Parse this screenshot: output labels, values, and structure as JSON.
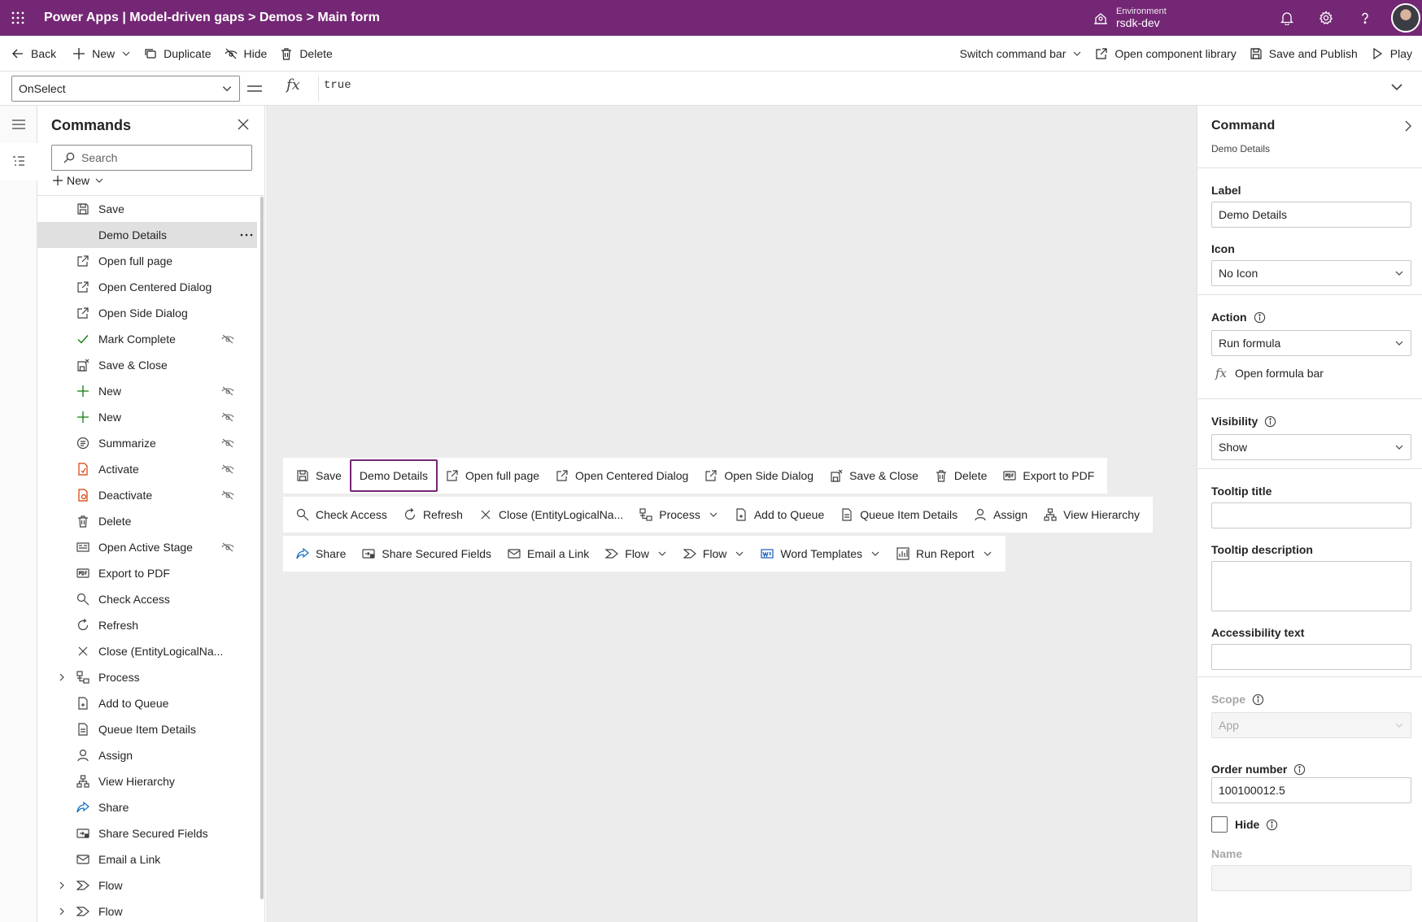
{
  "header": {
    "app_title": "Power Apps | Model-driven gaps > Demos > Main form",
    "env_label": "Environment",
    "env_name": "rsdk-dev",
    "brand_color": "#742774"
  },
  "command_bar": {
    "back": "Back",
    "new": "New",
    "duplicate": "Duplicate",
    "hide": "Hide",
    "delete": "Delete",
    "switch_command_bar": "Switch command bar",
    "open_component_library": "Open component library",
    "save_and_publish": "Save and Publish",
    "play": "Play"
  },
  "formula_bar": {
    "property": "OnSelect",
    "fx": "fx",
    "formula": "true"
  },
  "commands_panel": {
    "title": "Commands",
    "search_placeholder": "Search",
    "new_label": "New",
    "items": [
      {
        "label": "Save",
        "icon": "save-icon",
        "hidden": false,
        "expandable": false
      },
      {
        "label": "Demo Details",
        "icon": "none",
        "hidden": false,
        "expandable": false,
        "selected": true
      },
      {
        "label": "Open full page",
        "icon": "open-in-new-icon",
        "hidden": false,
        "expandable": false
      },
      {
        "label": "Open Centered Dialog",
        "icon": "open-in-new-icon",
        "hidden": false,
        "expandable": false
      },
      {
        "label": "Open Side Dialog",
        "icon": "open-in-new-icon",
        "hidden": false,
        "expandable": false
      },
      {
        "label": "Mark Complete",
        "icon": "checkmark-icon",
        "hidden": true,
        "expandable": false
      },
      {
        "label": "Save & Close",
        "icon": "save-close-icon",
        "hidden": false,
        "expandable": false
      },
      {
        "label": "New",
        "icon": "plus-icon",
        "hidden": true,
        "expandable": false
      },
      {
        "label": "New",
        "icon": "plus-icon",
        "hidden": true,
        "expandable": false
      },
      {
        "label": "Summarize",
        "icon": "summarize-icon",
        "hidden": true,
        "expandable": false
      },
      {
        "label": "Activate",
        "icon": "activate-icon",
        "hidden": true,
        "expandable": false
      },
      {
        "label": "Deactivate",
        "icon": "deactivate-icon",
        "hidden": true,
        "expandable": false
      },
      {
        "label": "Delete",
        "icon": "trash-icon",
        "hidden": false,
        "expandable": false
      },
      {
        "label": "Open Active Stage",
        "icon": "stage-icon",
        "hidden": true,
        "expandable": false
      },
      {
        "label": "Export to PDF",
        "icon": "pdf-icon",
        "hidden": false,
        "expandable": false
      },
      {
        "label": "Check Access",
        "icon": "key-search-icon",
        "hidden": false,
        "expandable": false
      },
      {
        "label": "Refresh",
        "icon": "refresh-icon",
        "hidden": false,
        "expandable": false
      },
      {
        "label": "Close (EntityLogicalNa...",
        "icon": "close-icon",
        "hidden": false,
        "expandable": false
      },
      {
        "label": "Process",
        "icon": "process-icon",
        "hidden": false,
        "expandable": true
      },
      {
        "label": "Add to Queue",
        "icon": "queue-add-icon",
        "hidden": false,
        "expandable": false
      },
      {
        "label": "Queue Item Details",
        "icon": "queue-icon",
        "hidden": false,
        "expandable": false
      },
      {
        "label": "Assign",
        "icon": "person-icon",
        "hidden": false,
        "expandable": false
      },
      {
        "label": "View Hierarchy",
        "icon": "hierarchy-icon",
        "hidden": false,
        "expandable": false
      },
      {
        "label": "Share",
        "icon": "share-icon",
        "hidden": false,
        "expandable": false
      },
      {
        "label": "Share Secured Fields",
        "icon": "share-secured-icon",
        "hidden": false,
        "expandable": false
      },
      {
        "label": "Email a Link",
        "icon": "mail-link-icon",
        "hidden": false,
        "expandable": false
      },
      {
        "label": "Flow",
        "icon": "flow-icon",
        "hidden": false,
        "expandable": true
      },
      {
        "label": "Flow",
        "icon": "flow-icon",
        "hidden": false,
        "expandable": true
      }
    ]
  },
  "preview": {
    "rows": [
      [
        {
          "label": "Save",
          "icon": "save-icon"
        },
        {
          "label": "Demo Details",
          "icon": "none",
          "selected": true
        },
        {
          "label": "Open full page",
          "icon": "open-in-new-icon"
        },
        {
          "label": "Open Centered Dialog",
          "icon": "open-in-new-icon"
        },
        {
          "label": "Open Side Dialog",
          "icon": "open-in-new-icon"
        },
        {
          "label": "Save & Close",
          "icon": "save-close-icon"
        },
        {
          "label": "Delete",
          "icon": "trash-icon"
        },
        {
          "label": "Export to PDF",
          "icon": "pdf-icon"
        }
      ],
      [
        {
          "label": "Check Access",
          "icon": "key-search-icon"
        },
        {
          "label": "Refresh",
          "icon": "refresh-icon"
        },
        {
          "label": "Close (EntityLogicalNa...",
          "icon": "close-icon"
        },
        {
          "label": "Process",
          "icon": "process-icon",
          "dropdown": true
        },
        {
          "label": "Add to Queue",
          "icon": "queue-add-icon"
        },
        {
          "label": "Queue Item Details",
          "icon": "queue-icon"
        },
        {
          "label": "Assign",
          "icon": "person-icon"
        },
        {
          "label": "View Hierarchy",
          "icon": "hierarchy-icon"
        }
      ],
      [
        {
          "label": "Share",
          "icon": "share-icon"
        },
        {
          "label": "Share Secured Fields",
          "icon": "share-secured-icon"
        },
        {
          "label": "Email a Link",
          "icon": "mail-link-icon"
        },
        {
          "label": "Flow",
          "icon": "flow-icon",
          "dropdown": true
        },
        {
          "label": "Flow",
          "icon": "flow-icon",
          "dropdown": true
        },
        {
          "label": "Word Templates",
          "icon": "word-template-icon",
          "dropdown": true
        },
        {
          "label": "Run Report",
          "icon": "report-icon",
          "dropdown": true
        }
      ]
    ]
  },
  "properties": {
    "title": "Command",
    "subtitle": "Demo Details",
    "label_label": "Label",
    "label_value": "Demo Details",
    "icon_label": "Icon",
    "icon_value": "No Icon",
    "action_label": "Action",
    "action_value": "Run formula",
    "open_formula_bar": "Open formula bar",
    "visibility_label": "Visibility",
    "visibility_value": "Show",
    "tooltip_title_label": "Tooltip title",
    "tooltip_title_value": "",
    "tooltip_description_label": "Tooltip description",
    "tooltip_description_value": "",
    "accessibility_label": "Accessibility text",
    "accessibility_value": "",
    "scope_label": "Scope",
    "scope_value": "App",
    "order_label": "Order number",
    "order_value": "100100012.5",
    "hide_label": "Hide",
    "name_label": "Name",
    "name_value": ""
  }
}
